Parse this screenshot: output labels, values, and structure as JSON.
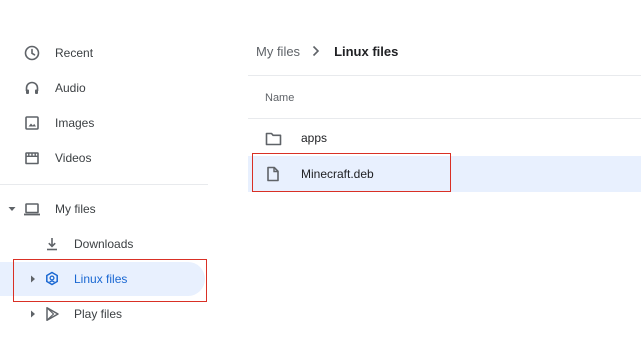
{
  "sidebar": {
    "items": [
      {
        "label": "Recent",
        "icon": "clock-icon"
      },
      {
        "label": "Audio",
        "icon": "headphones-icon"
      },
      {
        "label": "Images",
        "icon": "image-icon"
      },
      {
        "label": "Videos",
        "icon": "film-icon"
      },
      {
        "label": "My files",
        "icon": "laptop-icon",
        "expanded": true
      },
      {
        "label": "Downloads",
        "icon": "download-icon"
      },
      {
        "label": "Linux files",
        "icon": "linux-penguin-icon",
        "selected": true
      },
      {
        "label": "Play files",
        "icon": "play-store-icon"
      }
    ]
  },
  "breadcrumb": {
    "parent": "My files",
    "current": "Linux files"
  },
  "file_list": {
    "column_name": "Name",
    "rows": [
      {
        "name": "apps",
        "icon": "folder-icon"
      },
      {
        "name": "Minecraft.deb",
        "icon": "file-icon",
        "selected": true
      }
    ]
  },
  "colors": {
    "selected_bg": "#e8f0fe",
    "selected_text": "#1967d2",
    "highlight_border": "#d93025",
    "icon": "#5f6368"
  }
}
